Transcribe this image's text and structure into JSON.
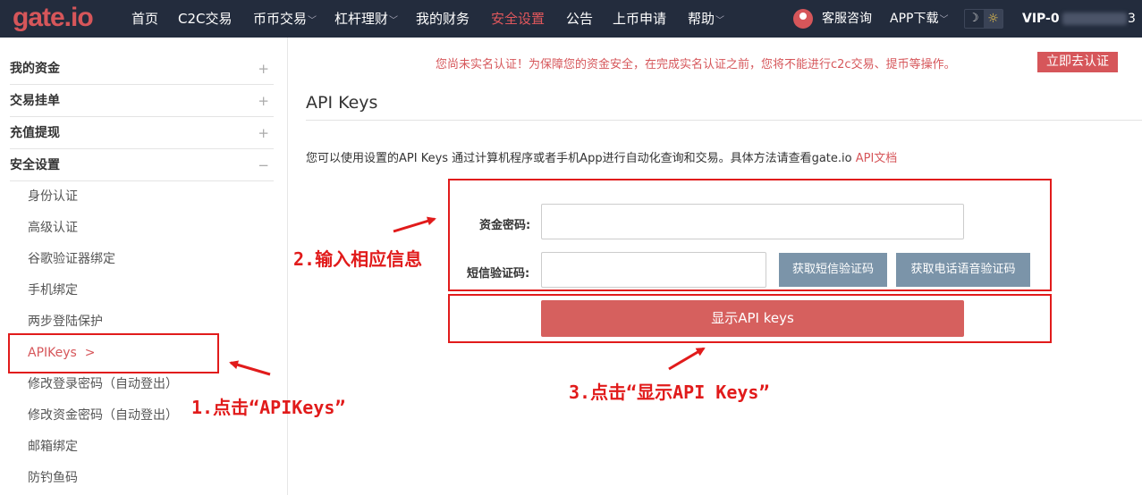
{
  "header": {
    "logo": "gate.io",
    "nav": [
      {
        "label": "首页",
        "dropdown": false,
        "active": false
      },
      {
        "label": "C2C交易",
        "dropdown": false,
        "active": false
      },
      {
        "label": "币币交易",
        "dropdown": true,
        "active": false
      },
      {
        "label": "杠杆理财",
        "dropdown": true,
        "active": false
      },
      {
        "label": "我的财务",
        "dropdown": false,
        "active": false
      },
      {
        "label": "安全设置",
        "dropdown": false,
        "active": true
      },
      {
        "label": "公告",
        "dropdown": false,
        "active": false
      },
      {
        "label": "上币申请",
        "dropdown": false,
        "active": false
      },
      {
        "label": "帮助",
        "dropdown": true,
        "active": false
      }
    ],
    "customer_service": "客服咨询",
    "app_download": "APP下载",
    "theme_icons": {
      "moon": "moon-icon",
      "sun": "sun-icon"
    },
    "vip_level": "VIP-0",
    "account_tail": "3"
  },
  "sidebar": {
    "groups": [
      {
        "label": "我的资金",
        "toggle": "+"
      },
      {
        "label": "交易挂单",
        "toggle": "+"
      },
      {
        "label": "充值提现",
        "toggle": "+"
      },
      {
        "label": "安全设置",
        "toggle": "−"
      }
    ],
    "sub_items": [
      {
        "label": "身份认证",
        "active": false
      },
      {
        "label": "高级认证",
        "active": false
      },
      {
        "label": "谷歌验证器绑定",
        "active": false
      },
      {
        "label": "手机绑定",
        "active": false
      },
      {
        "label": "两步登陆保护",
        "active": false
      },
      {
        "label": "APIKeys  >",
        "active": true
      },
      {
        "label": "修改登录密码（自动登出）",
        "active": false
      },
      {
        "label": "修改资金密码（自动登出）",
        "active": false
      },
      {
        "label": "邮箱绑定",
        "active": false
      },
      {
        "label": "防钓鱼码",
        "active": false
      }
    ]
  },
  "main": {
    "warning": "您尚未实名认证！为保障您的资金安全，在完成实名认证之前，您将不能进行c2c交易、提币等操作。",
    "warning_button": "立即去认证",
    "title": "API Keys",
    "description": "您可以使用设置的API Keys 通过计算机程序或者手机App进行自动化查询和交易。具体方法请查看gate.io ",
    "description_link": "API文档",
    "form": {
      "fund_password_label": "资金密码:",
      "fund_password_value": "",
      "sms_code_label": "短信验证码:",
      "sms_code_value": "",
      "sms_button": "获取短信验证码",
      "voice_button": "获取电话语音验证码",
      "show_button": "显示API keys"
    }
  },
  "annotations": {
    "step1": "1.点击“APIKeys”",
    "step2": "2.输入相应信息",
    "step3": "3.点击“显示API Keys”",
    "color": "#e11b1b"
  },
  "colors": {
    "header_bg": "#232c3d",
    "accent": "#d6565a",
    "gray_button": "#7b94a9"
  }
}
